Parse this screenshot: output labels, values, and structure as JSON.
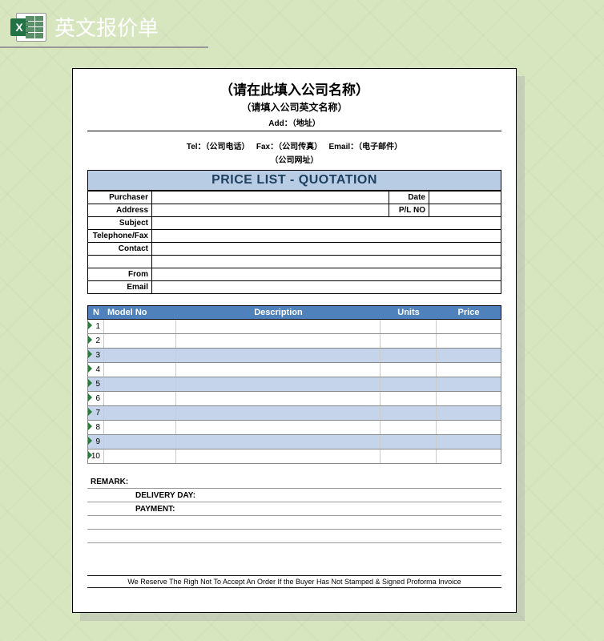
{
  "page": {
    "title": "英文报价单"
  },
  "company": {
    "cn_name": "（请在此填入公司名称）",
    "en_name": "（请填入公司英文名称）",
    "address_label": "Add：（地址）",
    "tel": "Tel：（公司电话）",
    "fax": "Fax：（公司传真）",
    "email": "Email：（电子邮件）",
    "website": "（公司网址）"
  },
  "sheet_title": "PRICE LIST - QUOTATION",
  "info": {
    "purchaser_label": "Purchaser",
    "address_label": "Address",
    "subject_label": "Subject",
    "telfax_label": "Telephone/Fax",
    "contact_label": "Contact",
    "from_label": "From",
    "email_label": "Email",
    "date_label": "Date",
    "plno_label": "P/L NO",
    "purchaser": "",
    "address": "",
    "subject": "",
    "telfax": "",
    "contact": "",
    "from": "",
    "email2": "",
    "date": "",
    "plno": ""
  },
  "columns": {
    "n": "N",
    "model": "Model No",
    "desc": "Description",
    "units": "Units",
    "price": "Price"
  },
  "rows": [
    {
      "n": "1",
      "model": "",
      "desc": "",
      "units": "",
      "price": ""
    },
    {
      "n": "2",
      "model": "",
      "desc": "",
      "units": "",
      "price": ""
    },
    {
      "n": "3",
      "model": "",
      "desc": "",
      "units": "",
      "price": ""
    },
    {
      "n": "4",
      "model": "",
      "desc": "",
      "units": "",
      "price": ""
    },
    {
      "n": "5",
      "model": "",
      "desc": "",
      "units": "",
      "price": ""
    },
    {
      "n": "6",
      "model": "",
      "desc": "",
      "units": "",
      "price": ""
    },
    {
      "n": "7",
      "model": "",
      "desc": "",
      "units": "",
      "price": ""
    },
    {
      "n": "8",
      "model": "",
      "desc": "",
      "units": "",
      "price": ""
    },
    {
      "n": "9",
      "model": "",
      "desc": "",
      "units": "",
      "price": ""
    },
    {
      "n": "10",
      "model": "",
      "desc": "",
      "units": "",
      "price": ""
    }
  ],
  "remark": {
    "label": "REMARK:",
    "delivery_label": "DELIVERY DAY:",
    "payment_label": "PAYMENT:",
    "delivery": "",
    "payment": ""
  },
  "footer": "We Reserve The Righ Not To Accept An Order If the Buyer Has Not Stamped & Signed Proforma Invoice"
}
